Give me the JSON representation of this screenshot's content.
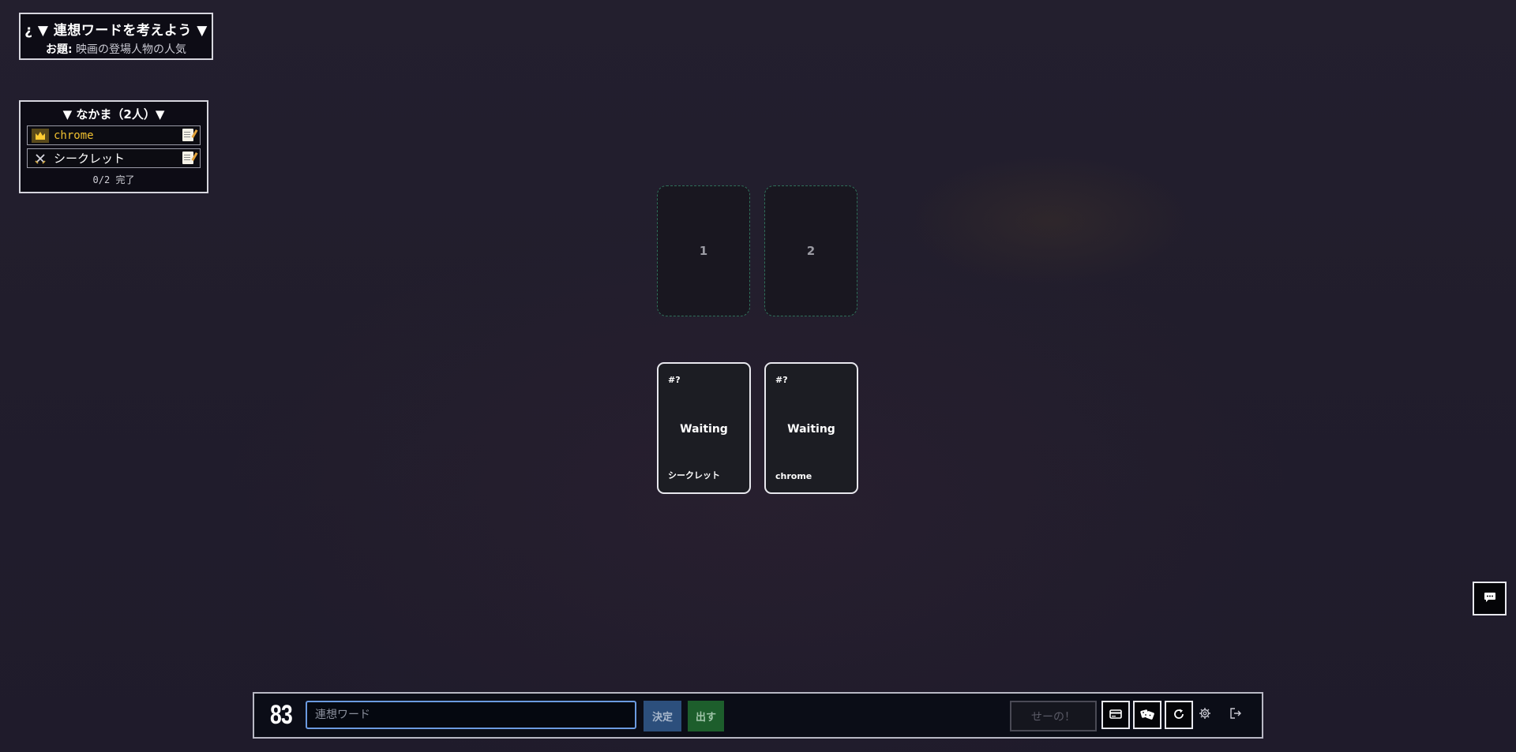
{
  "topic": {
    "title": "¿ ▼ 連想ワードを考えよう ▼",
    "subject_label": "お題:",
    "subject_value": "映画の登場人物の人気"
  },
  "party": {
    "title": "▼ なかま（2人）▼",
    "members": [
      {
        "name": "chrome",
        "role_icon": "crown-icon",
        "leader": true
      },
      {
        "name": "シークレット",
        "role_icon": "crossed-swords-icon",
        "leader": false
      }
    ],
    "status": "0/2 完了"
  },
  "slots": [
    {
      "label": "1"
    },
    {
      "label": "2"
    }
  ],
  "cards": [
    {
      "number": "#?",
      "state": "Waiting",
      "owner": "シークレット"
    },
    {
      "number": "#?",
      "state": "Waiting",
      "owner": "chrome"
    }
  ],
  "bottom_bar": {
    "timer": "83",
    "word_input_value": "",
    "word_input_placeholder": "連想ワード",
    "decide_label": "決定",
    "play_label": "出す",
    "seeno_label": "せーの！"
  },
  "icons": {
    "chat": "chat-bubble-icon",
    "card": "card-icon",
    "dice": "dice-icon",
    "reload": "reload-icon",
    "gear": "gear-icon",
    "exit": "logout-icon"
  },
  "colors": {
    "background": "#221e2d",
    "leader_name": "#f0c030",
    "decide_button": "#2c4f7c",
    "play_button": "#1d5e2c",
    "input_focus_border": "#6b9ae0",
    "slot_border": "#2f6f5a"
  }
}
